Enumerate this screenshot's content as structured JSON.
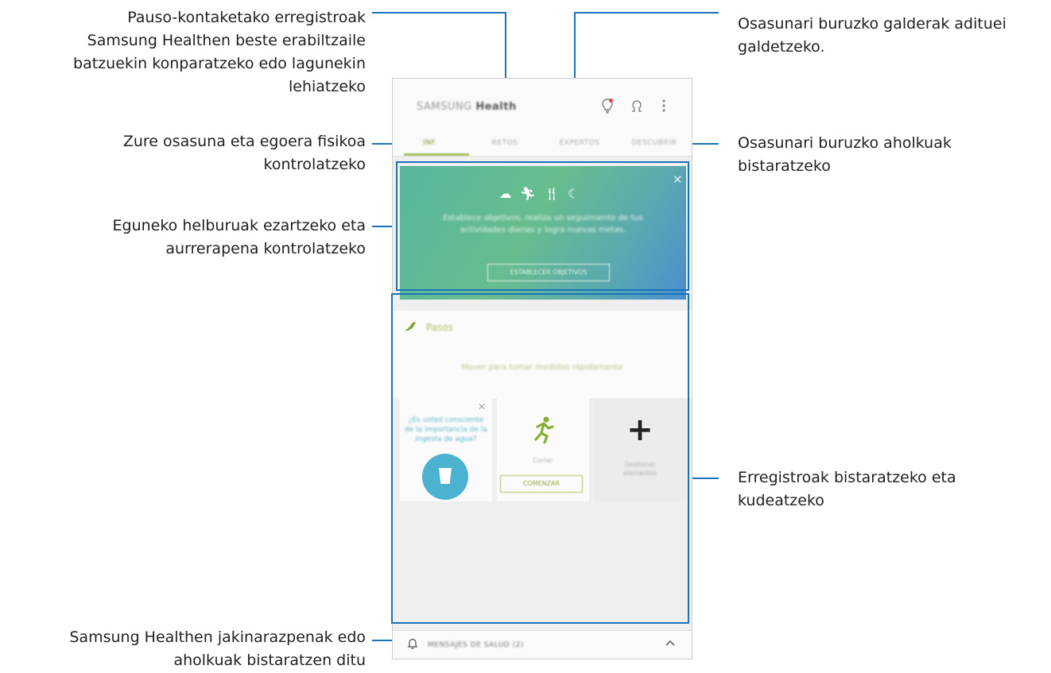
{
  "callouts": {
    "steps_compare": "Pauso-kontaketako erregistroak\nSamsung Healthen beste erabiltzaile\nbatzuekin konparatzeko edo lagunekin\nlehiatzeko",
    "expert_questions": "Osasunari buruzko galderak adituei\ngaldetzeko.",
    "health_status": "Zure osasuna eta egoera fisikoa\nkontrolatzeko",
    "health_tips": "Osasunari buruzko aholkuak\nbistaratzeko",
    "daily_goals": "Eguneko helburuak ezartzeko eta\naurrerapena kontrolatzeko",
    "records": "Erregistroak bistaratzeko eta\nkudeatzeko",
    "notifications": "Samsung Healthen jakinarazpenak edo\naholkuak bistaratzen ditu"
  },
  "app": {
    "title_prefix": "SAMSUNG",
    "title_main": "Health",
    "icons": [
      "lightbulb-icon",
      "expert-icon",
      "more-icon"
    ],
    "tabs": [
      {
        "label": "INF.",
        "active": true
      },
      {
        "label": "RETOS",
        "active": false
      },
      {
        "label": "EXPERTOS",
        "active": false
      },
      {
        "label": "DESCUBRIR",
        "active": false
      }
    ],
    "banner": {
      "text": "Establece objetivos, realiza un seguimiento de tus actividades diarias y logra nuevas metas.",
      "button": "ESTABLECER OBJETIVOS",
      "icons": [
        "lungs-icon",
        "run-icon",
        "meal-icon",
        "moon-icon"
      ]
    },
    "steps": {
      "title": "Pasos",
      "empty": "Mover para tomar medidas rápidamente"
    },
    "tiles": {
      "water_text": "¿Es usted consciente de la importancia de la ingesta de agua?",
      "exercise_label": "Correr",
      "exercise_button": "COMENZAR",
      "add_label": "Gestionar elementos"
    },
    "bottom": {
      "label": "MENSAJES DE SALUD (2)"
    }
  },
  "colors": {
    "accent_line": "#1a73b8",
    "brand_green": "#86ad2e",
    "water_blue": "#4bb2cf"
  }
}
